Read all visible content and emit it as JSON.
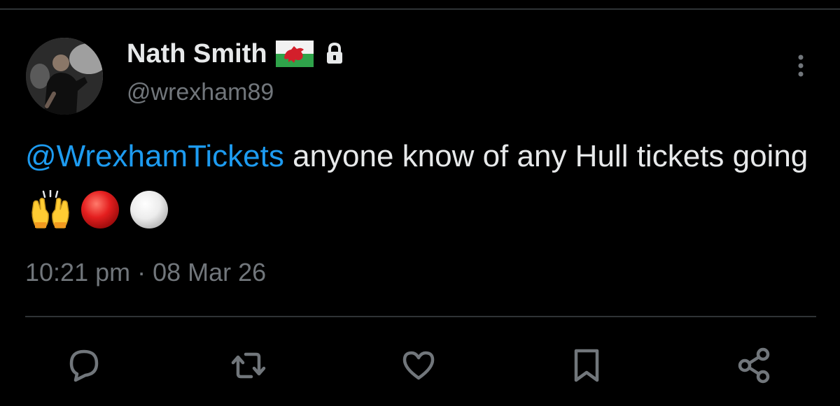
{
  "tweet": {
    "author": {
      "display_name": "Nath Smith",
      "handle": "@wrexham89",
      "flag_icon": "wales-flag-icon",
      "protected_icon": "lock-icon"
    },
    "text": {
      "mention": "@WrexhamTickets",
      "body": " anyone know of any Hull tickets going",
      "emojis": [
        "raising-hands-emoji",
        "red-circle-emoji",
        "white-circle-emoji"
      ]
    },
    "timestamp": "10:21 pm · 08 Mar 26"
  },
  "actions": [
    {
      "name": "reply",
      "icon": "reply-icon"
    },
    {
      "name": "repost",
      "icon": "repost-icon"
    },
    {
      "name": "like",
      "icon": "heart-icon"
    },
    {
      "name": "bookmark",
      "icon": "bookmark-icon"
    },
    {
      "name": "share",
      "icon": "share-icon"
    }
  ],
  "colors": {
    "background": "#000000",
    "text_primary": "#e7e9ea",
    "text_secondary": "#71767b",
    "accent": "#1d9bf0",
    "divider": "#2f3336"
  }
}
